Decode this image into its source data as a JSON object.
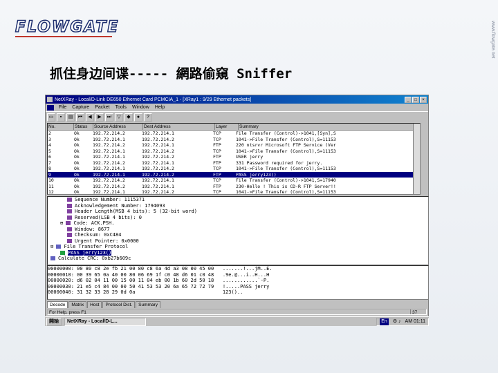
{
  "slide": {
    "logo": "FLOWGATE",
    "title": "抓住身边间谍----- 網路偷窺 Sniffer",
    "watermark": "www.flowgate.net"
  },
  "app": {
    "title": "NetXRay - Local/D-Link DE650 Ethernet Card PCMCIA_1 - [XRay1 : 9/29 Ethernet packets]",
    "menu": [
      "File",
      "Capture",
      "Packet",
      "Tools",
      "Window",
      "Help"
    ],
    "columns": [
      "No.",
      "Status",
      "Source Address",
      "Dest Address",
      "Layer",
      "Summary"
    ],
    "packets": [
      [
        "2",
        "Ok",
        "192.72.214.2",
        "192.72.214.1",
        "TCP",
        "File Transfer (Control)->1041,[Syn],S"
      ],
      [
        "3",
        "Ok",
        "192.72.214.1",
        "192.72.214.2",
        "TCP",
        "1041->File Transfer (Control),S=11153"
      ],
      [
        "4",
        "Ok",
        "192.72.214.2",
        "192.72.214.1",
        "FTP",
        "220 ntsrvr Microsoft FTP Service (Ver"
      ],
      [
        "5",
        "Ok",
        "192.72.214.1",
        "192.72.214.2",
        "TCP",
        "1041->File Transfer (Control),S=11153"
      ],
      [
        "6",
        "Ok",
        "192.72.214.1",
        "192.72.214.2",
        "FTP",
        "USER jerry"
      ],
      [
        "7",
        "Ok",
        "192.72.214.2",
        "192.72.214.1",
        "FTP",
        "331 Password required for jerry."
      ],
      [
        "8",
        "Ok",
        "192.72.214.1",
        "192.72.214.2",
        "TCP",
        "1041->File Transfer (Control),S=11153"
      ],
      [
        "9",
        "Ok",
        "192.72.214.1",
        "192.72.214.2",
        "FTP",
        "PASS jerry123()"
      ],
      [
        "10",
        "Ok",
        "192.72.214.2",
        "192.72.214.1",
        "TCP",
        "File Transfer (Control)->1041,S=17940"
      ],
      [
        "11",
        "Ok",
        "192.72.214.2",
        "192.72.214.1",
        "FTP",
        "230-Hello ! This is CD-R FTP Server!!"
      ],
      [
        "12",
        "Ok",
        "192.72.214.1",
        "192.72.214.2",
        "TCP",
        "1041->File Transfer (Control),S=11153"
      ]
    ],
    "selected_packet": "9",
    "decode_tree": [
      "Sequence Number: 1115371",
      "Acknowledgement Number: 1794093",
      "Header Length(MSB 4 bits): 5 (32-bit word)",
      "Reserved(LSB 4 bits): 0",
      "Code: ACK.PSH.",
      "Window: 8677",
      "Checksum: 0xC484",
      "Urgent Pointer: 0x0000",
      "File Transfer Protocol",
      "PASS jerry123()",
      "Calculate CRC: 0xb27b609c"
    ],
    "hex_dump": [
      "00000000: 00 80 c8 2e fb 21 00 80 c8 6a 4d a3 08 00 45 00   .......!...jM..E.",
      "00000010: 00 39 65 0a 40 00 80 06 69 1f c0 48 d6 01 c0 48   .9e.@...i..H...H",
      "00000020: d6 02 04 11 00 15 00 11 04 eb 00 1b 60 2d 50 18   ............`-P.",
      "00000030: 21 e5 c4 84 00 00 50 41 53 53 20 6a 65 72 72 79   !.....PASS jerry",
      "00000040: 31 32 33 28 29 0d 0a                              123()..         "
    ],
    "tabs": [
      "Decode",
      "Matrix",
      "Host",
      "Protocol Dist.",
      "Summary"
    ],
    "active_tab": "Decode",
    "status_text": "For Help, press F1",
    "status_page": "37"
  },
  "taskbar": {
    "start": "開始",
    "task": "NetXRay - Local/D-L...",
    "lang": "En",
    "clock": "AM 01:11"
  }
}
